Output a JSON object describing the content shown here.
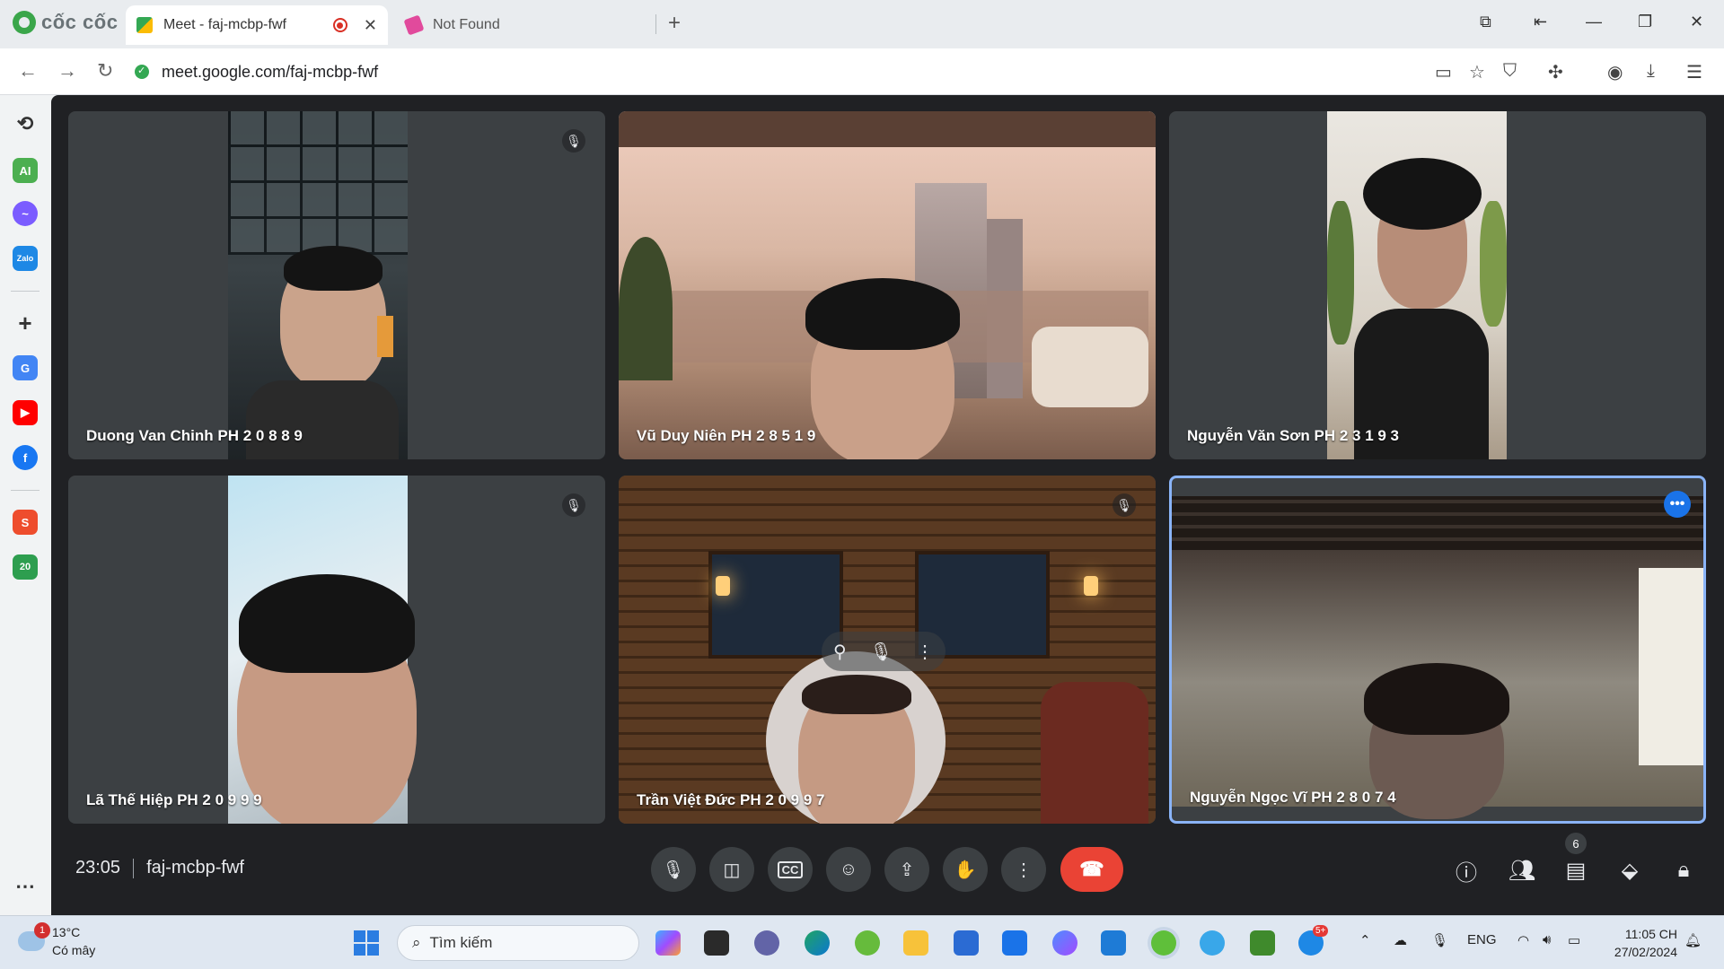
{
  "browser": {
    "brand": "cốc cốc",
    "tabs": [
      {
        "title": "Meet - faj-mcbp-fwf",
        "active": true
      },
      {
        "title": "Not Found",
        "active": false
      }
    ],
    "url": "meet.google.com/faj-mcbp-fwf"
  },
  "meeting": {
    "time": "23:05",
    "code": "faj-mcbp-fwf",
    "participant_count": "6",
    "participants": [
      {
        "name": "Duong Van Chinh PH 2 0 8 8 9",
        "muted": true
      },
      {
        "name": "Vũ Duy Niên PH 2 8 5 1 9",
        "muted": false
      },
      {
        "name": "Nguyễn Văn Sơn PH 2 3 1 9 3",
        "muted": false
      },
      {
        "name": "Lã Thế Hiệp PH 2 0 9 9 9",
        "muted": true
      },
      {
        "name": "Trần Việt Đức PH 2 0 9 9 7",
        "muted": true
      },
      {
        "name": "Nguyễn Ngọc Vĩ PH 2 8 0 7 4",
        "muted": false,
        "speaking": true
      }
    ]
  },
  "taskbar": {
    "weather_temp": "13°C",
    "weather_desc": "Có mây",
    "weather_badge": "1",
    "search_placeholder": "Tìm kiếm",
    "zalo_badge": "5+",
    "language": "ENG",
    "time": "11:05 CH",
    "date": "27/02/2024"
  },
  "colors": {
    "meet_bg": "#202124",
    "tile_bg": "#3c4043",
    "end_call": "#ea4335",
    "accent": "#1a73e8"
  }
}
